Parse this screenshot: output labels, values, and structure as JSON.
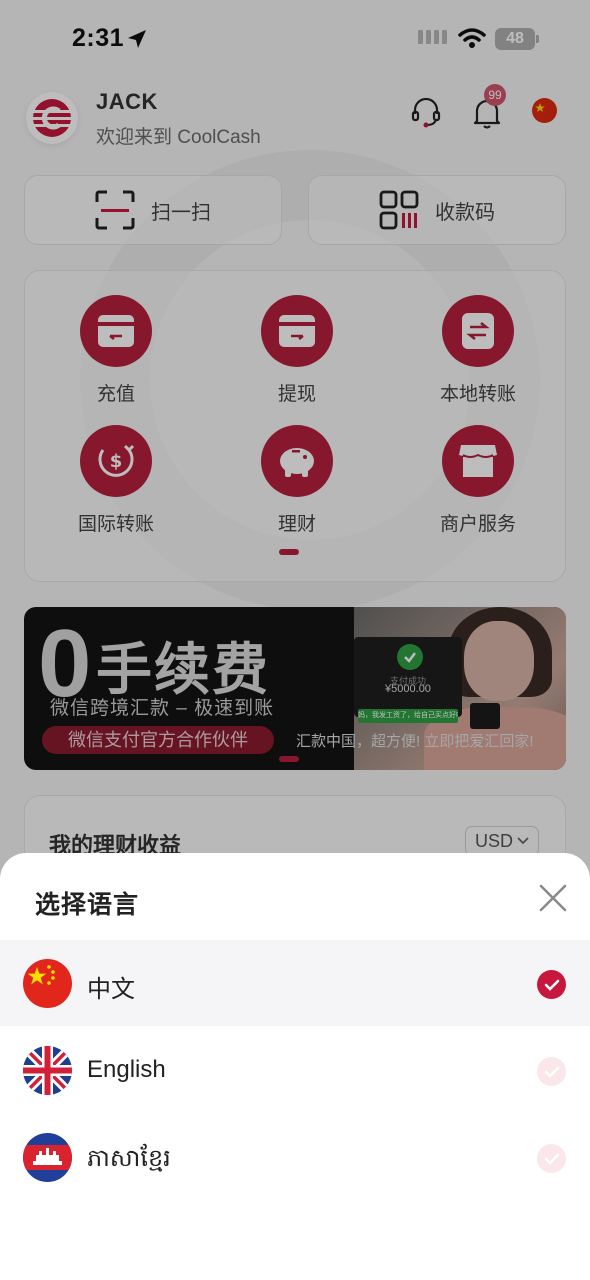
{
  "status_bar": {
    "time": "2:31",
    "battery": "48"
  },
  "header": {
    "username": "JACK",
    "welcome": "欢迎来到 CoolCash",
    "notification_count": "99"
  },
  "actions": [
    {
      "label": "扫一扫",
      "icon": "scan-icon"
    },
    {
      "label": "收款码",
      "icon": "qr-code-icon"
    }
  ],
  "services": [
    {
      "label": "充值",
      "icon": "wallet-deposit-icon"
    },
    {
      "label": "提现",
      "icon": "wallet-withdraw-icon"
    },
    {
      "label": "本地转账",
      "icon": "transfer-icon"
    },
    {
      "label": "国际转账",
      "icon": "dollar-exchange-icon"
    },
    {
      "label": "理财",
      "icon": "piggy-bank-icon"
    },
    {
      "label": "商户服务",
      "icon": "store-icon"
    }
  ],
  "banner": {
    "zero": "0",
    "headline": "手续费",
    "subline": "微信跨境汇款 – 极速到账",
    "pill": "微信支付官方合作伙伴",
    "slogan": "汇款中国，超方便! 立即把爱汇回家!",
    "pay_status": "支付成功",
    "pay_amount": "¥5000.00",
    "chat_text": "妈，我发工资了，给自己买点好吃的"
  },
  "earnings": {
    "title": "我的理财收益",
    "currency": "USD"
  },
  "language_sheet": {
    "title": "选择语言",
    "options": [
      {
        "name": "中文",
        "flag": "china-flag",
        "selected": true
      },
      {
        "name": "English",
        "flag": "uk-flag",
        "selected": false
      },
      {
        "name": "ភាសាខ្មែរ",
        "flag": "cambodia-flag",
        "selected": false
      }
    ]
  },
  "colors": {
    "brand_red": "#c8173d",
    "service_red": "#b5203c",
    "check_off": "#fbe6ea"
  }
}
